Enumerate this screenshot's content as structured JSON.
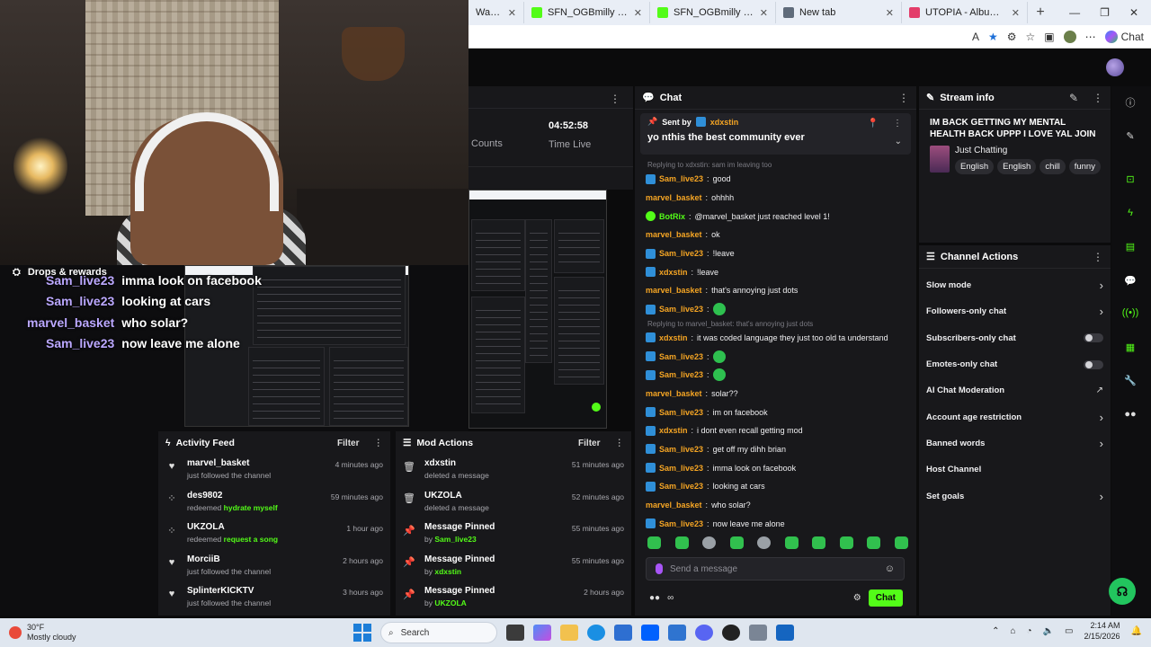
{
  "browser": {
    "tabs": [
      {
        "title": "Watch clips",
        "color": "#53fc18"
      },
      {
        "title": "SFN_OGBmilly - Watch clips",
        "color": "#53fc18"
      },
      {
        "title": "SFN_OGBmilly - Watch clips",
        "color": "#53fc18"
      },
      {
        "title": "New tab",
        "color": "#5f6b7a"
      },
      {
        "title": "UTOPIA - Album by Travis Sc",
        "color": "#e33d6a"
      }
    ],
    "new_tab": "+",
    "copilot_label": "Chat"
  },
  "overlay": {
    "drops_label": "Drops & rewards",
    "lines": [
      {
        "user": "Sam_live23",
        "msg": "imma look on facebook"
      },
      {
        "user": "Sam_live23",
        "msg": "looking at cars"
      },
      {
        "user": "marvel_basket",
        "msg": "who solar?"
      },
      {
        "user": "Sam_live23",
        "msg": "now leave me alone"
      }
    ]
  },
  "stats": {
    "counts_label": "Counts",
    "time_value": "04:52:58",
    "time_label": "Time Live"
  },
  "chat": {
    "title": "Chat",
    "pinned": {
      "sent_by": "Sent by",
      "user": "xdxstin",
      "message": "yo nthis the best community ever"
    },
    "messages": [
      {
        "kind": "reply",
        "text": "Replying to xdxstin: sam im leaving too"
      },
      {
        "kind": "msg",
        "badge": "kick",
        "user": "Sam_live23",
        "color": "#f5a524",
        "text": "good"
      },
      {
        "kind": "msg",
        "badge": "",
        "user": "marvel_basket",
        "color": "#f5a524",
        "text": "ohhhh"
      },
      {
        "kind": "msg",
        "badge": "bot",
        "user": "BotRix",
        "color": "#53fc18",
        "text": "@marvel_basket just reached level 1!"
      },
      {
        "kind": "msg",
        "badge": "",
        "user": "marvel_basket",
        "color": "#f5a524",
        "text": "ok"
      },
      {
        "kind": "msg",
        "badge": "kick",
        "user": "Sam_live23",
        "color": "#f5a524",
        "text": "!leave"
      },
      {
        "kind": "msg",
        "badge": "kick",
        "user": "xdxstin",
        "color": "#f5a524",
        "text": "!leave"
      },
      {
        "kind": "msg",
        "badge": "",
        "user": "marvel_basket",
        "color": "#f5a524",
        "text": "that's annoying just dots"
      },
      {
        "kind": "msg",
        "badge": "kick",
        "user": "Sam_live23",
        "color": "#f5a524",
        "text": "",
        "emote": true
      },
      {
        "kind": "reply",
        "text": "Replying to marvel_basket: that's annoying just dots"
      },
      {
        "kind": "msg",
        "badge": "kick",
        "user": "xdxstin",
        "color": "#f5a524",
        "text": "it was coded language they just too old ta understand"
      },
      {
        "kind": "msg",
        "badge": "kick",
        "user": "Sam_live23",
        "color": "#f5a524",
        "text": "",
        "emote": true
      },
      {
        "kind": "msg",
        "badge": "kick",
        "user": "Sam_live23",
        "color": "#f5a524",
        "text": "",
        "emote": true
      },
      {
        "kind": "msg",
        "badge": "",
        "user": "marvel_basket",
        "color": "#f5a524",
        "text": "solar??"
      },
      {
        "kind": "msg",
        "badge": "kick",
        "user": "Sam_live23",
        "color": "#f5a524",
        "text": "im on facebook"
      },
      {
        "kind": "msg",
        "badge": "kick",
        "user": "xdxstin",
        "color": "#f5a524",
        "text": "i dont even recall getting mod"
      },
      {
        "kind": "msg",
        "badge": "kick",
        "user": "Sam_live23",
        "color": "#f5a524",
        "text": "get off my dihh brian"
      },
      {
        "kind": "msg",
        "badge": "kick",
        "user": "Sam_live23",
        "color": "#f5a524",
        "text": "imma look on facebook"
      },
      {
        "kind": "msg",
        "badge": "kick",
        "user": "Sam_live23",
        "color": "#f5a524",
        "text": "looking at cars"
      },
      {
        "kind": "msg",
        "badge": "",
        "user": "marvel_basket",
        "color": "#f5a524",
        "text": "who solar?"
      },
      {
        "kind": "msg",
        "badge": "kick",
        "user": "Sam_live23",
        "color": "#f5a524",
        "text": "now leave me alone"
      }
    ],
    "input_placeholder": "Send a message",
    "send_label": "Chat"
  },
  "stream_info": {
    "title": "Stream info",
    "stream_title": "IM BACK GETTING MY MENTAL HEALTH BACK UPPP I LOVE YAL JOIN UPPP BIG...",
    "category": "Just Chatting",
    "tags": [
      "English",
      "English",
      "chill",
      "funny"
    ]
  },
  "channel_actions": {
    "title": "Channel Actions",
    "items": [
      {
        "label": "Slow mode",
        "control": "chevron"
      },
      {
        "label": "Followers-only chat",
        "control": "chevron"
      },
      {
        "label": "Subscribers-only chat",
        "control": "toggle"
      },
      {
        "label": "Emotes-only chat",
        "control": "toggle"
      },
      {
        "label": "AI Chat Moderation",
        "control": "external"
      },
      {
        "label": "Account age restriction",
        "control": "chevron"
      },
      {
        "label": "Banned words",
        "control": "chevron"
      },
      {
        "label": "Host Channel",
        "control": "none"
      },
      {
        "label": "Set goals",
        "control": "chevron"
      }
    ]
  },
  "activity_feed": {
    "title": "Activity Feed",
    "filter_label": "Filter",
    "items": [
      {
        "icon": "heart-icon",
        "name": "marvel_basket",
        "sub": "just followed the channel",
        "hl": "",
        "time": "4 minutes ago"
      },
      {
        "icon": "dots-icon",
        "name": "des9802",
        "sub": "redeemed",
        "hl": "hydrate myself",
        "time": "59 minutes ago"
      },
      {
        "icon": "dots-icon",
        "name": "UKZOLA",
        "sub": "redeemed",
        "hl": "request a song",
        "time": "1 hour ago"
      },
      {
        "icon": "heart-icon",
        "name": "MorciiB",
        "sub": "just followed the channel",
        "hl": "",
        "time": "2 hours ago"
      },
      {
        "icon": "heart-icon",
        "name": "SplinterKICKTV",
        "sub": "just followed the channel",
        "hl": "",
        "time": "3 hours ago"
      }
    ]
  },
  "mod_actions": {
    "title": "Mod Actions",
    "filter_label": "Filter",
    "items": [
      {
        "icon": "trash-icon",
        "name": "xdxstin",
        "sub": "deleted a message",
        "by": "",
        "time": "51 minutes ago"
      },
      {
        "icon": "trash-icon",
        "name": "UKZOLA",
        "sub": "deleted a message",
        "by": "",
        "time": "52 minutes ago"
      },
      {
        "icon": "pin-icon",
        "name": "Message Pinned",
        "sub": "by",
        "by": "Sam_live23",
        "time": "55 minutes ago"
      },
      {
        "icon": "pin-icon",
        "name": "Message Pinned",
        "sub": "by",
        "by": "xdxstin",
        "time": "55 minutes ago"
      },
      {
        "icon": "pin-icon",
        "name": "Message Pinned",
        "sub": "by",
        "by": "UKZOLA",
        "time": "2 hours ago"
      }
    ]
  },
  "taskbar": {
    "temp": "30°F",
    "weather": "Mostly cloudy",
    "search_label": "Search",
    "time": "2:14 AM",
    "date": "2/15/2026"
  }
}
